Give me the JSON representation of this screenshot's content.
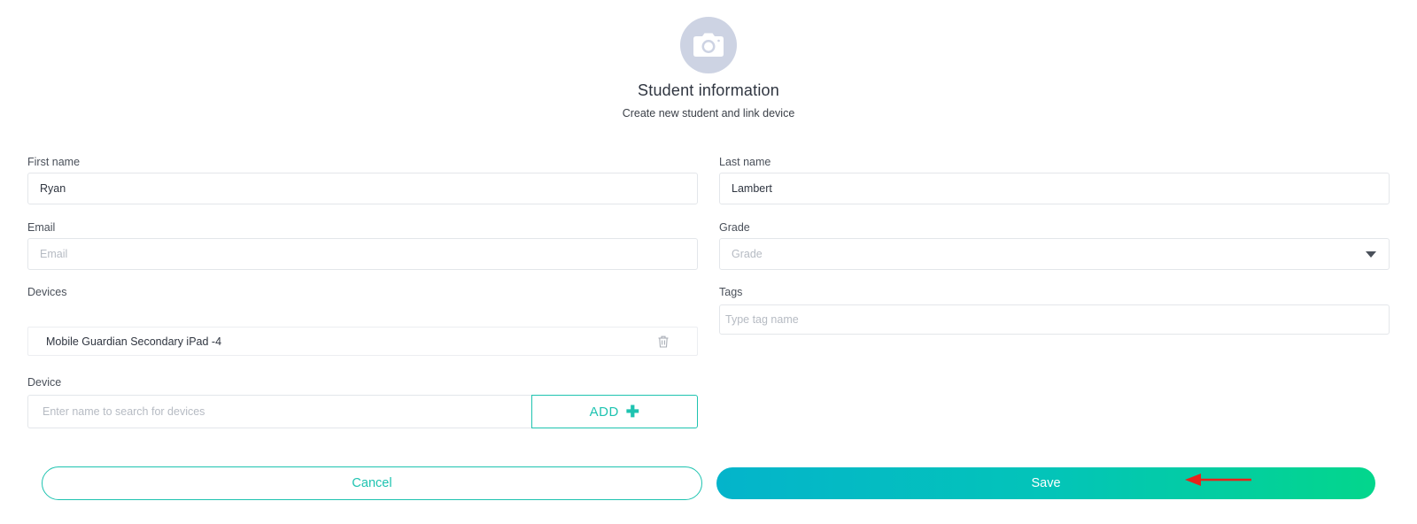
{
  "header": {
    "title": "Student information",
    "subtitle": "Create new student and link device",
    "avatar_icon": "camera-icon"
  },
  "form": {
    "first_name": {
      "label": "First name",
      "value": "Ryan"
    },
    "last_name": {
      "label": "Last name",
      "value": "Lambert"
    },
    "email": {
      "label": "Email",
      "value": "",
      "placeholder": "Email"
    },
    "grade": {
      "label": "Grade",
      "placeholder": "Grade"
    },
    "devices": {
      "label": "Devices",
      "items": [
        {
          "name": "Mobile Guardian Secondary iPad -4"
        }
      ]
    },
    "tags": {
      "label": "Tags",
      "placeholder": "Type tag name"
    },
    "device": {
      "label": "Device",
      "placeholder": "Enter name to search for devices",
      "add_label": "ADD"
    }
  },
  "actions": {
    "cancel_label": "Cancel",
    "save_label": "Save"
  },
  "colors": {
    "accent": "#1ec3b0",
    "save_gradient_start": "#04b4cb",
    "save_gradient_end": "#03d68c",
    "avatar_bg": "#cdd3e3",
    "annotation": "#e8231a"
  }
}
